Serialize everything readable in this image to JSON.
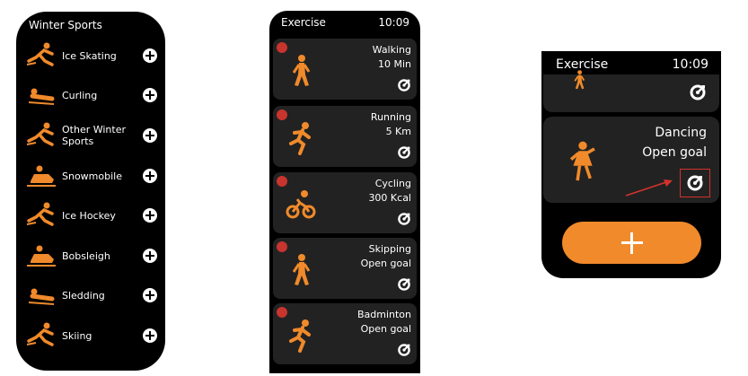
{
  "colors": {
    "accent": "#f08a2b",
    "card": "#222222",
    "delete": "#c8342e",
    "highlight": "#d3332c"
  },
  "winter_sports": {
    "title": "Winter Sports",
    "items": [
      {
        "label": "Ice Skating",
        "icon": "ice-skating-icon"
      },
      {
        "label": "Curling",
        "icon": "curling-icon"
      },
      {
        "label": "Other Winter Sports",
        "icon": "other-winter-sports-icon"
      },
      {
        "label": "Snowmobile",
        "icon": "snowmobile-icon"
      },
      {
        "label": "Ice Hockey",
        "icon": "ice-hockey-icon"
      },
      {
        "label": "Bobsleigh",
        "icon": "bobsleigh-icon"
      },
      {
        "label": "Sledding",
        "icon": "sledding-icon"
      },
      {
        "label": "Skiing",
        "icon": "skiing-icon"
      }
    ]
  },
  "exercise_list": {
    "title": "Exercise",
    "time": "10:09",
    "items": [
      {
        "name": "Walking",
        "value": "10 Min",
        "icon": "walking-icon"
      },
      {
        "name": "Running",
        "value": "5 Km",
        "icon": "running-icon"
      },
      {
        "name": "Cycling",
        "value": "300 Kcal",
        "icon": "cycling-icon"
      },
      {
        "name": "Skipping",
        "value": "Open goal",
        "icon": "skipping-icon"
      },
      {
        "name": "Badminton",
        "value": "Open goal",
        "icon": "badminton-icon"
      }
    ]
  },
  "exercise_detail": {
    "title": "Exercise",
    "time": "10:09",
    "card": {
      "name": "Dancing",
      "value": "Open goal",
      "icon": "dancing-icon"
    }
  }
}
